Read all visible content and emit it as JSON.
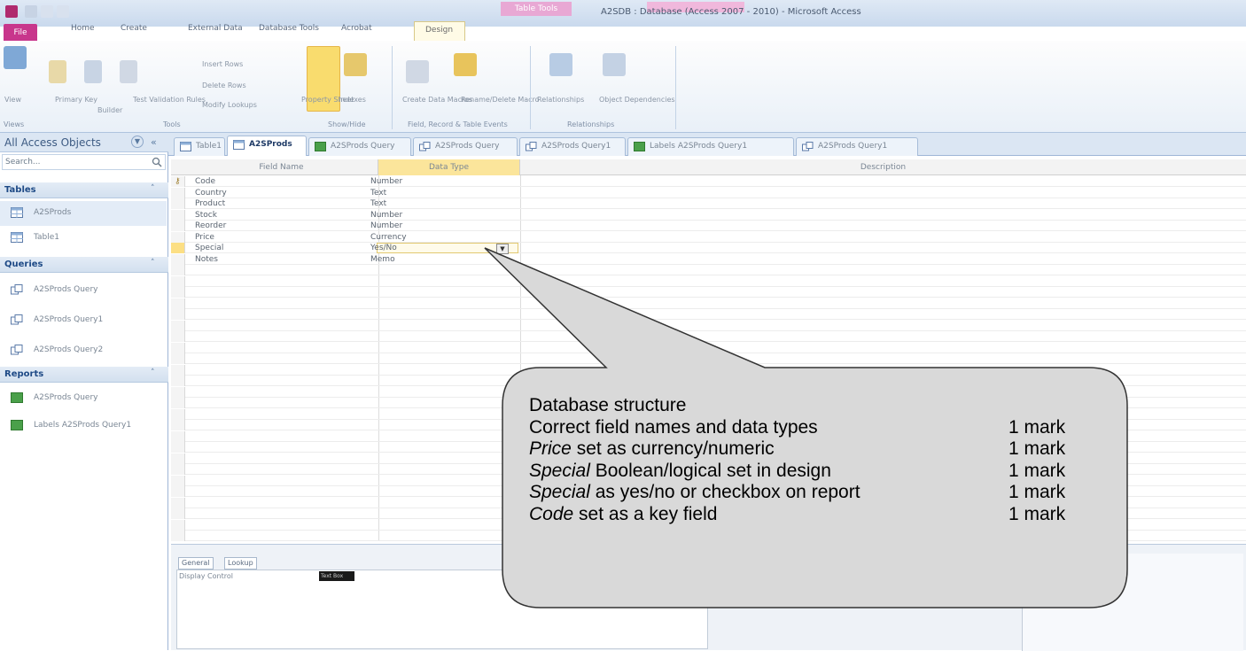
{
  "window": {
    "title": "A2SDB : Database (Access 2007 - 2010) - Microsoft Access",
    "context_tab_group": "Table Tools"
  },
  "ribbon": {
    "tabs": [
      "File",
      "Home",
      "Create",
      "External Data",
      "Database Tools",
      "Acrobat",
      "Design"
    ],
    "groups": [
      "Views",
      "Tools",
      "Show/Hide",
      "Field, Record & Table Events",
      "Relationships"
    ],
    "buttons": {
      "view": "View",
      "primary_key": "Primary Key",
      "builder": "Builder",
      "test_validation": "Test Validation Rules",
      "insert_rows": "Insert Rows",
      "delete_rows": "Delete Rows",
      "modify_lookups": "Modify Lookups",
      "property_sheet": "Property Sheet",
      "indexes": "Indexes",
      "create_data_macros": "Create Data Macros",
      "rename_delete_macro": "Rename/Delete Macro",
      "relationships": "Relationships",
      "object_dependencies": "Object Dependencies"
    }
  },
  "nav": {
    "header": "All Access Objects",
    "search_placeholder": "Search...",
    "groups": [
      {
        "label": "Tables",
        "items": [
          "A2SProds",
          "Table1"
        ]
      },
      {
        "label": "Queries",
        "items": [
          "A2SProds Query",
          "A2SProds Query1",
          "A2SProds Query2"
        ]
      },
      {
        "label": "Reports",
        "items": [
          "A2SProds Query",
          "Labels A2SProds Query1"
        ]
      }
    ]
  },
  "doc_tabs": [
    "Table1",
    "A2SProds",
    "A2SProds Query",
    "A2SProds Query",
    "A2SProds Query1",
    "Labels A2SProds Query1",
    "A2SProds Query1"
  ],
  "grid": {
    "headers": {
      "field": "Field Name",
      "type": "Data Type",
      "description": "Description"
    },
    "rows": [
      {
        "field": "Code",
        "type": "Number"
      },
      {
        "field": "Country",
        "type": "Text"
      },
      {
        "field": "Product",
        "type": "Text"
      },
      {
        "field": "Stock",
        "type": "Number"
      },
      {
        "field": "Reorder",
        "type": "Number"
      },
      {
        "field": "Price",
        "type": "Currency"
      },
      {
        "field": "Special",
        "type": "Yes/No"
      },
      {
        "field": "Notes",
        "type": "Memo"
      }
    ]
  },
  "properties": {
    "tabs": [
      "General",
      "Lookup"
    ],
    "label": "Display Control",
    "value": "Text Box"
  },
  "callout": {
    "title": "Database structure",
    "lines": [
      {
        "em": "",
        "text": "Correct field names and data types",
        "mark": "1 mark"
      },
      {
        "em": "Price",
        "text": " set as currency/numeric",
        "mark": "1 mark"
      },
      {
        "em": "Special",
        "text": " Boolean/logical set in design",
        "mark": "1 mark"
      },
      {
        "em": "Special",
        "text": " as yes/no or checkbox on report",
        "mark": "1 mark"
      },
      {
        "em": "Code",
        "text": " set as a key field",
        "mark": "1 mark"
      }
    ]
  },
  "colors": {
    "file_tab": "#c8368c",
    "accent_yellow": "#fbe59b",
    "nav_blue": "#1e4a86"
  }
}
